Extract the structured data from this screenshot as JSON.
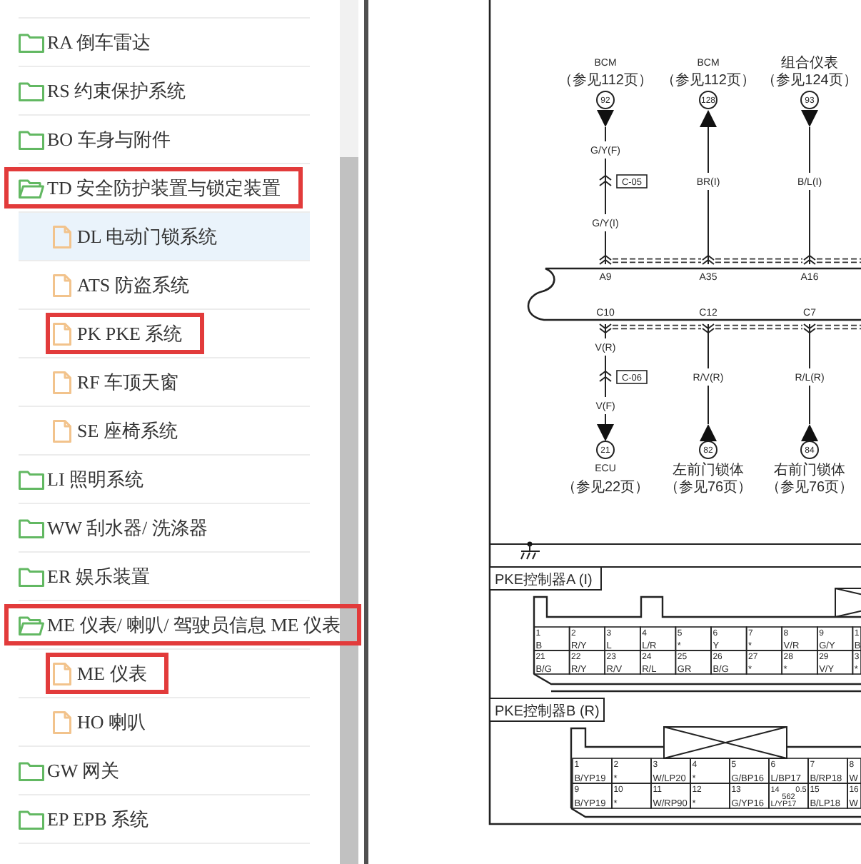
{
  "tree": [
    {
      "kind": "folder",
      "label": "RA 倒车雷达",
      "expanded": false,
      "selected": false,
      "marked": false
    },
    {
      "kind": "folder",
      "label": "RS 约束保护系统",
      "expanded": false,
      "selected": false,
      "marked": false
    },
    {
      "kind": "folder",
      "label": "BO 车身与附件",
      "expanded": false,
      "selected": false,
      "marked": false
    },
    {
      "kind": "folder",
      "label": "TD 安全防护装置与锁定装置",
      "expanded": true,
      "selected": false,
      "marked": true,
      "children": [
        {
          "kind": "file",
          "label": "DL 电动门锁系统",
          "selected": true,
          "marked": false
        },
        {
          "kind": "file",
          "label": "ATS 防盗系统",
          "selected": false,
          "marked": false
        },
        {
          "kind": "file",
          "label": "PK PKE 系统",
          "selected": false,
          "marked": true
        },
        {
          "kind": "file",
          "label": "RF 车顶天窗",
          "selected": false,
          "marked": false
        },
        {
          "kind": "file",
          "label": "SE 座椅系统",
          "selected": false,
          "marked": false
        }
      ]
    },
    {
      "kind": "folder",
      "label": "LI 照明系统",
      "expanded": false,
      "selected": false,
      "marked": false
    },
    {
      "kind": "folder",
      "label": "WW 刮水器/ 洗涤器",
      "expanded": false,
      "selected": false,
      "marked": false
    },
    {
      "kind": "folder",
      "label": "ER 娱乐装置",
      "expanded": false,
      "selected": false,
      "marked": false
    },
    {
      "kind": "folder",
      "label": "ME 仪表/ 喇叭/ 驾驶员信息 ME 仪表",
      "expanded": true,
      "selected": false,
      "marked": true,
      "children": [
        {
          "kind": "file",
          "label": "ME 仪表",
          "selected": false,
          "marked": true
        },
        {
          "kind": "file",
          "label": "HO 喇叭",
          "selected": false,
          "marked": false
        }
      ]
    },
    {
      "kind": "folder",
      "label": "GW 网关",
      "expanded": false,
      "selected": false,
      "marked": false
    },
    {
      "kind": "folder",
      "label": "EP EPB 系统",
      "expanded": false,
      "selected": false,
      "marked": false
    }
  ],
  "diagram": {
    "upper_terminals": [
      {
        "name": "BCM",
        "ref": "（参见112页）",
        "pin": "92",
        "kind": "down",
        "wire_labels": [
          "G/Y(F)",
          "G/Y(I)"
        ],
        "splice": "C-05",
        "harness_pin": "A9"
      },
      {
        "name": "BCM",
        "ref": "（参见112页）",
        "pin": "128",
        "kind": "up",
        "wire_labels": [
          "BR(I)"
        ],
        "harness_pin": "A35"
      },
      {
        "name": "组合仪表",
        "ref": "（参见124页）",
        "pin": "93",
        "kind": "down",
        "wire_labels": [
          "B/L(I)"
        ],
        "harness_pin": "A16"
      }
    ],
    "lower_terminals": [
      {
        "harness_pin": "C10",
        "wire_labels": [
          "V(R)",
          "V(F)"
        ],
        "splice": "C-06",
        "kind": "down",
        "pin": "21",
        "name": "ECU",
        "ref": "（参见22页）"
      },
      {
        "harness_pin": "C12",
        "wire_labels": [
          "R/V(R)"
        ],
        "kind": "up",
        "pin": "82",
        "name": "左前门锁体",
        "ref": "（参见76页）"
      },
      {
        "harness_pin": "C7",
        "wire_labels": [
          "R/L(R)"
        ],
        "kind": "up",
        "pin": "84",
        "name": "右前门锁体",
        "ref": "（参见76页）"
      }
    ],
    "connectors": [
      {
        "title": "PKE控制器A (I)",
        "rows": [
          [
            {
              "pin": "1",
              "wire": "B"
            },
            {
              "pin": "2",
              "wire": "R/Y"
            },
            {
              "pin": "3",
              "wire": "L"
            },
            {
              "pin": "4",
              "wire": "L/R"
            },
            {
              "pin": "5",
              "wire": "*"
            },
            {
              "pin": "6",
              "wire": "Y"
            },
            {
              "pin": "7",
              "wire": "*"
            },
            {
              "pin": "8",
              "wire": "V/R"
            },
            {
              "pin": "9",
              "wire": "G/Y"
            },
            {
              "pin": "1",
              "wire": "B"
            }
          ],
          [
            {
              "pin": "21",
              "wire": "B/G"
            },
            {
              "pin": "22",
              "wire": "R/Y"
            },
            {
              "pin": "23",
              "wire": "R/V"
            },
            {
              "pin": "24",
              "wire": "R/L"
            },
            {
              "pin": "25",
              "wire": "GR"
            },
            {
              "pin": "26",
              "wire": "B/G"
            },
            {
              "pin": "27",
              "wire": "*"
            },
            {
              "pin": "28",
              "wire": "*"
            },
            {
              "pin": "29",
              "wire": "V/Y"
            },
            {
              "pin": "3",
              "wire": "*"
            }
          ]
        ]
      },
      {
        "title": "PKE控制器B (R)",
        "rows": [
          [
            {
              "pin": "1",
              "wire": "B/YP19"
            },
            {
              "pin": "2",
              "wire": "*"
            },
            {
              "pin": "3",
              "wire": "W/LP20"
            },
            {
              "pin": "4",
              "wire": "*"
            },
            {
              "pin": "5",
              "wire": "G/BP16"
            },
            {
              "pin": "6",
              "wire": "L/BP17"
            },
            {
              "pin": "7",
              "wire": "B/RP18"
            },
            {
              "pin": "8",
              "wire": "W"
            }
          ],
          [
            {
              "pin": "9",
              "wire": "B/YP19"
            },
            {
              "pin": "10",
              "wire": "*"
            },
            {
              "pin": "11",
              "wire": "W/RP90"
            },
            {
              "pin": "12",
              "wire": "*"
            },
            {
              "pin": "13",
              "wire": "G/YP16"
            },
            {
              "pin": "14",
              "wire": "L/YP17",
              "gauge": "0.5",
              "circuit": "562"
            },
            {
              "pin": "15",
              "wire": "B/LP18"
            },
            {
              "pin": "16",
              "wire": "W"
            }
          ]
        ]
      }
    ]
  }
}
